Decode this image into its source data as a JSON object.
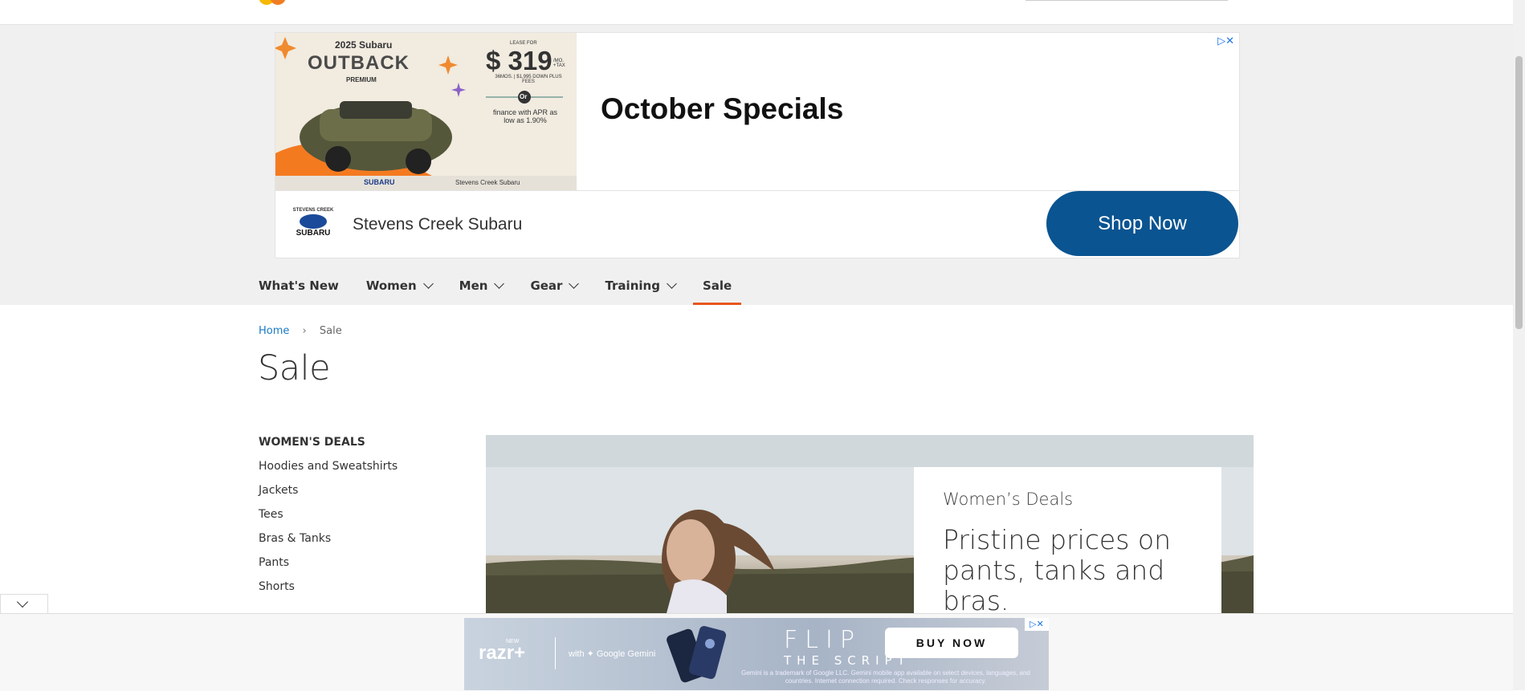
{
  "ad_top": {
    "image": {
      "year_model": "2025 Subaru",
      "model": "OUTBACK",
      "trim": "PREMIUM",
      "lease_label": "LEASE FOR",
      "price": "$ 319",
      "price_suffix": "/MO. +TAX",
      "terms": "36MOS. | $1,995 DOWN PLUS FEES",
      "or": "Or",
      "finance": "finance with APR as low as 1.90%",
      "brand": "SUBARU",
      "dealer": "Stevens Creek Subaru"
    },
    "adchoice": "▷✕",
    "headline": "October Specials",
    "advertiser_logo_top": "STEVENS CREEK",
    "advertiser_logo_bottom": "SUBARU",
    "advertiser": "Stevens Creek Subaru",
    "cta": "Shop Now"
  },
  "nav": {
    "items": [
      {
        "label": "What's New",
        "has_menu": false
      },
      {
        "label": "Women",
        "has_menu": true
      },
      {
        "label": "Men",
        "has_menu": true
      },
      {
        "label": "Gear",
        "has_menu": true
      },
      {
        "label": "Training",
        "has_menu": true
      },
      {
        "label": "Sale",
        "has_menu": false,
        "active": true
      }
    ]
  },
  "breadcrumb": {
    "home": "Home",
    "separator": "›",
    "current": "Sale"
  },
  "page_title": "Sale",
  "sidebar": {
    "heading": "WOMEN'S DEALS",
    "items": [
      "Hoodies and Sweatshirts",
      "Jackets",
      "Tees",
      "Bras & Tanks",
      "Pants",
      "Shorts"
    ]
  },
  "hero": {
    "eyebrow": "Women’s Deals",
    "headline": "Pristine prices on pants, tanks and bras."
  },
  "ad_bottom": {
    "brand_new": "NEW",
    "brand": "razr+",
    "gemini": "with ✦ Google Gemini",
    "flip": "FLIP",
    "script": "THE SCRIPT",
    "cta": "BUY NOW",
    "fine_print": "Gemini is a trademark of Google LLC. Gemini mobile app available on select devices, languages, and countries. Internet connection required. Check responses for accuracy.",
    "adchoice": "▷✕"
  },
  "colors": {
    "accent": "#e8571f",
    "link": "#1979c3",
    "cta_blue": "#0a5491"
  }
}
